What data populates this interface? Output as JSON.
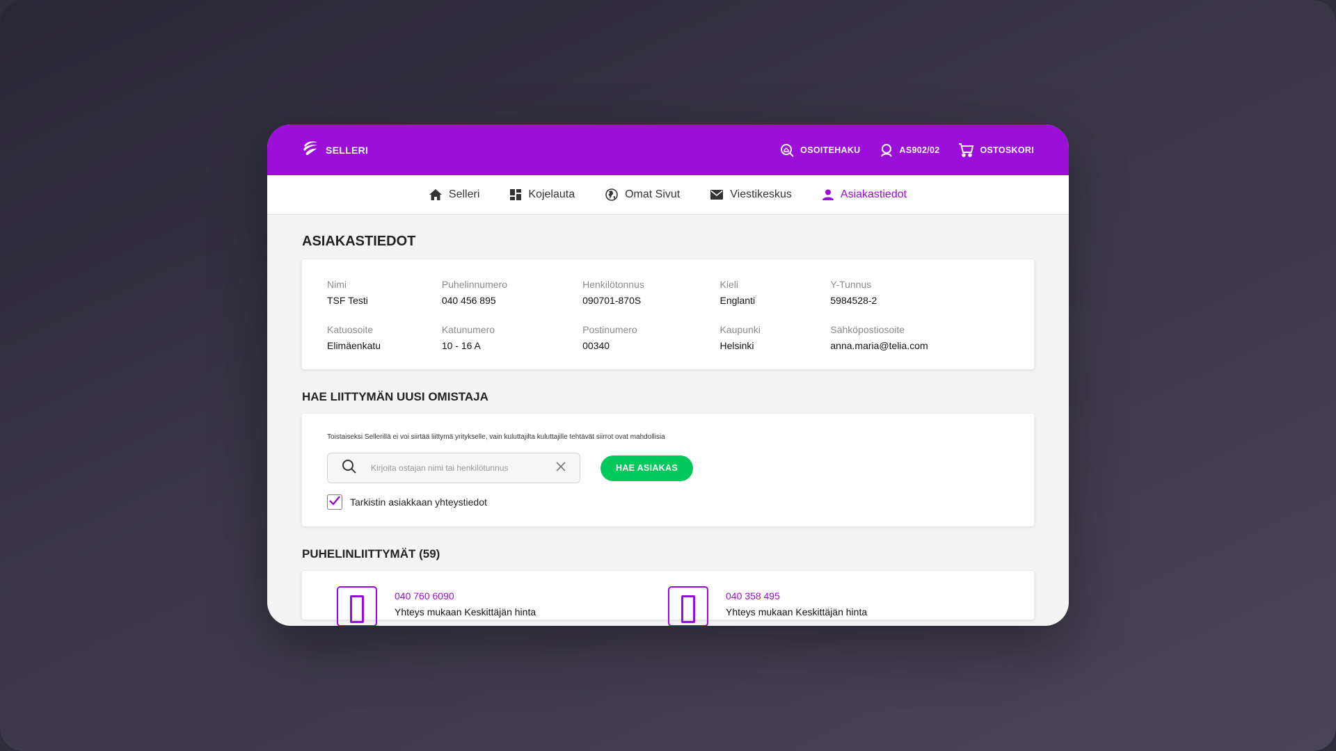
{
  "header": {
    "brand": "SELLERI",
    "nav": [
      {
        "label": "OSOITEHAKU",
        "icon": "address-search-icon"
      },
      {
        "label": "AS902/02",
        "icon": "user-headset-icon"
      },
      {
        "label": "OSTOSKORI",
        "icon": "cart-icon"
      }
    ]
  },
  "subnav": [
    {
      "label": "Selleri",
      "icon": "home-icon",
      "active": false
    },
    {
      "label": "Kojelauta",
      "icon": "dashboard-icon",
      "active": false
    },
    {
      "label": "Omat Sivut",
      "icon": "globe-icon",
      "active": false
    },
    {
      "label": "Viestikeskus",
      "icon": "mail-icon",
      "active": false
    },
    {
      "label": "Asiakastiedot",
      "icon": "user-icon",
      "active": true
    }
  ],
  "customer": {
    "title": "ASIAKASTIEDOT",
    "fields": [
      {
        "label": "Nimi",
        "value": "TSF Testi"
      },
      {
        "label": "Puhelinnumero",
        "value": "040 456 895"
      },
      {
        "label": "Henkilötonnus",
        "value": "090701-870S"
      },
      {
        "label": "Kieli",
        "value": "Englanti"
      },
      {
        "label": "Y-Tunnus",
        "value": "5984528-2"
      },
      {
        "label": "Katuosoite",
        "value": "Elimäenkatu"
      },
      {
        "label": "Katunumero",
        "value": "10 - 16 A"
      },
      {
        "label": "Postinumero",
        "value": "00340"
      },
      {
        "label": "Kaupunki",
        "value": "Helsinki"
      },
      {
        "label": "Sähköpostiosoite",
        "value": "anna.maria@telia.com"
      }
    ]
  },
  "owner_search": {
    "title": "HAE LIITTYMÄN UUSI OMISTAJA",
    "note": "Toistaiseksi Sellerillä ei voi siirtää liittymä yritykselle, vain kuluttajilta kuluttajille tehtävät siirrot ovat mahdollisia",
    "placeholder": "Kirjoita ostajan nimi tai henkilötunnus",
    "value": "",
    "button": "HAE ASIAKAS",
    "checkbox_label": "Tarkistin asiakkaan yhteystiedot",
    "checked": true
  },
  "lines": {
    "title": "PUHELINLIITTYMÄT (59)",
    "items": [
      {
        "number": "040 760 6090",
        "desc": "Yhteys mukaan Keskittäjän hinta"
      },
      {
        "number": "040 358 495",
        "desc": "Yhteys mukaan Keskittäjän hinta"
      }
    ]
  },
  "colors": {
    "brand": "#9b0fd9",
    "accent": "#990ae3",
    "success": "#00c85a"
  }
}
